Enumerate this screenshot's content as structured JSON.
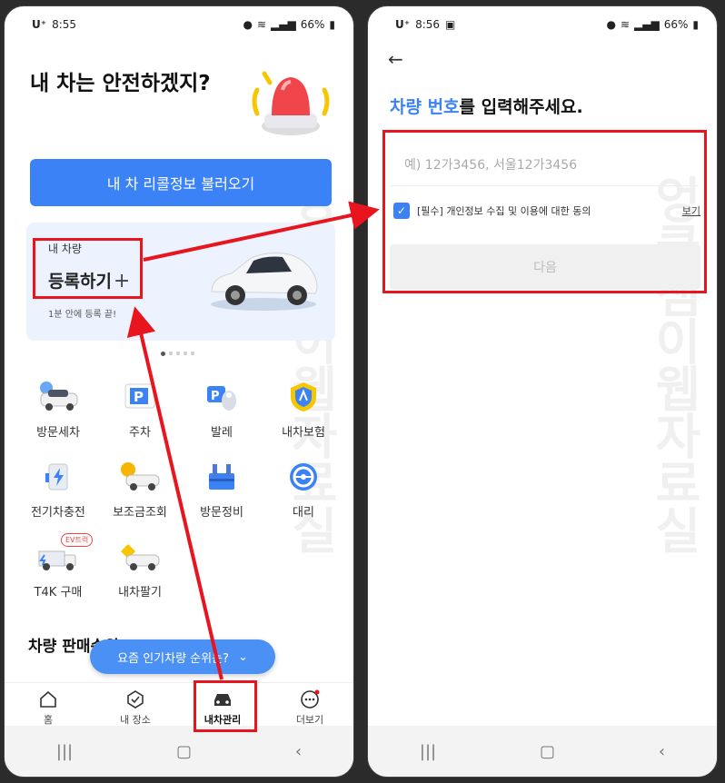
{
  "left": {
    "status": {
      "carrier": "U⁺",
      "time": "8:55",
      "battery": "66%"
    },
    "hero_title": "내 차는 안전하겠지?",
    "recall_button": "내 차 리콜정보 불러오기",
    "car_card": {
      "label": "내 차량",
      "register": "등록하기",
      "plus": "+",
      "subtitle": "1분 안에 등록 끝!"
    },
    "services": [
      {
        "label": "방문세차",
        "icon": "car-wash-icon"
      },
      {
        "label": "주차",
        "icon": "parking-icon"
      },
      {
        "label": "발레",
        "icon": "valet-icon"
      },
      {
        "label": "내차보험",
        "icon": "insurance-shield-icon"
      },
      {
        "label": "전기차충전",
        "icon": "ev-charger-icon"
      },
      {
        "label": "보조금조회",
        "icon": "subsidy-car-icon"
      },
      {
        "label": "방문정비",
        "icon": "maintenance-icon"
      },
      {
        "label": "대리",
        "icon": "steering-wheel-icon"
      },
      {
        "label": "T4K 구매",
        "icon": "truck-icon",
        "badge": "EV트럭"
      },
      {
        "label": "내차팔기",
        "icon": "sell-car-icon"
      }
    ],
    "section_title": "차량 판매순위",
    "float_pill": "요즘 인기차량 순위는?",
    "tabs": [
      {
        "label": "홈",
        "icon": "home-icon"
      },
      {
        "label": "내 장소",
        "icon": "place-check-icon"
      },
      {
        "label": "내차관리",
        "icon": "car-icon"
      },
      {
        "label": "더보기",
        "icon": "more-dots-icon"
      }
    ],
    "watermark": "엉클샘이웹자료실"
  },
  "right": {
    "status": {
      "carrier": "U⁺",
      "time": "8:56",
      "battery": "66%"
    },
    "title_highlight": "차량 번호",
    "title_rest": "를 입력해주세요.",
    "plate_placeholder": "예) 12가3456, 서울12가3456",
    "consent_text": "[필수] 개인정보 수집 및 이용에 대한 동의",
    "consent_view": "보기",
    "next_button": "다음",
    "watermark": "엉클샘이웹자료실"
  },
  "colors": {
    "accent": "#3b82f6",
    "annotation": "#e8141e"
  }
}
